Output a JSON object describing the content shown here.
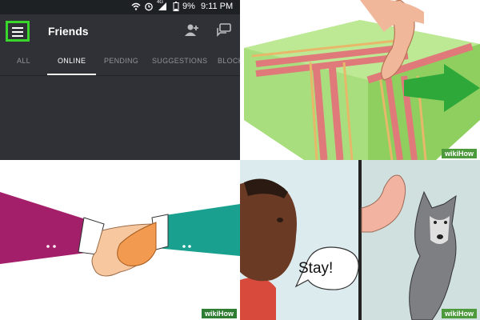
{
  "status_bar": {
    "battery_percent": "9%",
    "time": "9:11 PM",
    "network_label": "4G"
  },
  "app_bar": {
    "title": "Friends"
  },
  "tabs": [
    "ALL",
    "ONLINE",
    "PENDING",
    "SUGGESTIONS",
    "BLOCK"
  ],
  "active_tab": "ONLINE",
  "speech_bubble": {
    "text": "Stay!"
  },
  "watermark": {
    "text": "wikiHow"
  },
  "colors": {
    "highlight": "#39d72c",
    "arrow": "#2fa83a",
    "app_background": "#2f3136"
  },
  "icons": [
    "menu-icon",
    "add-friend-icon",
    "direct-message-icon"
  ]
}
